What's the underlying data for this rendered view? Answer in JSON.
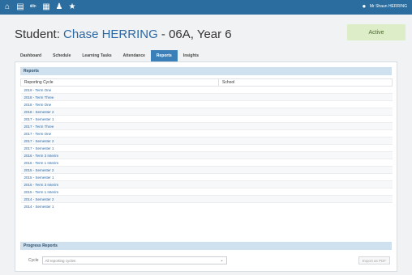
{
  "topbar": {
    "icons": [
      "home-icon",
      "calendar-icon",
      "pencil-icon",
      "grid-icon",
      "people-icon",
      "star-icon"
    ],
    "user_label": "Mr Shaun HERRING"
  },
  "header": {
    "title_prefix": "Student: ",
    "student_name": "Chase HERRING",
    "title_suffix": " - 06A, Year 6",
    "status": "Active"
  },
  "tabs": [
    {
      "label": "Dashboard",
      "active": false
    },
    {
      "label": "Schedule",
      "active": false
    },
    {
      "label": "Learning Tasks",
      "active": false
    },
    {
      "label": "Attendance",
      "active": false
    },
    {
      "label": "Reports",
      "active": true
    },
    {
      "label": "Insights",
      "active": false
    }
  ],
  "reports": {
    "heading": "Reports",
    "columns": [
      "Reporting Cycle",
      "School"
    ],
    "rows": [
      "2019 - Term One",
      "2018 - Term Three",
      "2018 - Term One",
      "2018 - Semester 2",
      "2017 - Semester 1",
      "2017 - Term Three",
      "2017 - Term One",
      "2017 - Semester 2",
      "2017 - Semester 1",
      "2016 - Term 3 Interim",
      "2016 - Term 1 Interim",
      "2015 - Semester 2",
      "2015 - Semester 1",
      "2015 - Term 3 Interim",
      "2015 - Term 1 Interim",
      "2014 - Semester 2",
      "2014 - Semester 1"
    ]
  },
  "progress": {
    "heading": "Progress Reports",
    "cycle_label": "Cycle",
    "cycle_value": "All reporting cycles",
    "export_label": "Export as PDF"
  },
  "colors": {
    "topbar": "#2a6d9e",
    "tab_active": "#3b7fb8",
    "link": "#2b67a4",
    "section_header": "#cfe0ee",
    "status_badge": "#dcedc8"
  }
}
